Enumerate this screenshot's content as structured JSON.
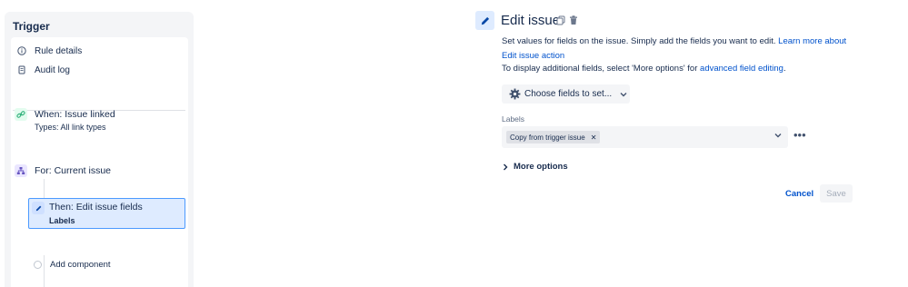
{
  "sidebar": {
    "title": "Trigger",
    "links": [
      {
        "label": "Rule details",
        "icon": "info-icon"
      },
      {
        "label": "Audit log",
        "icon": "document-icon"
      }
    ],
    "trigger": {
      "title": "When: Issue linked",
      "subtitle": "Types: All link types",
      "icon": "link-icon",
      "color": "#36b37e"
    },
    "branch": {
      "title": "For: Current issue",
      "icon": "branch-icon",
      "color": "#6554c0"
    },
    "action": {
      "title": "Then: Edit issue fields",
      "subtitle": "Labels",
      "icon": "pencil-icon"
    },
    "add_component": "Add component"
  },
  "panel": {
    "title": "Edit issue",
    "description": "Set values for fields on the issue. Simply add the fields you want to edit.",
    "learn_more": "Learn more about Edit issue action",
    "additional_prefix": "To display additional fields, select 'More options' for",
    "advanced_link": "advanced field editing",
    "additional_suffix": ".",
    "choose_fields": "Choose fields to set...",
    "labels_caption": "Labels",
    "label_tag": "Copy from trigger issue",
    "more_options": "More options",
    "cancel": "Cancel",
    "save": "Save"
  },
  "colors": {
    "accent": "#0052cc",
    "selected_bg": "#deebff",
    "selected_border": "#4c9aff"
  }
}
